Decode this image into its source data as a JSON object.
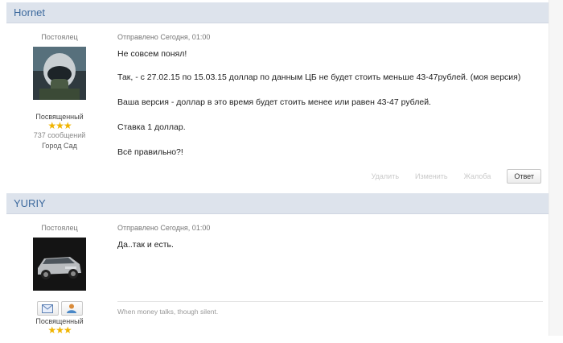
{
  "posts": [
    {
      "author": "Hornet",
      "rank_top": "Постоялец",
      "rank_name": "Посвященный",
      "stars": "★★★",
      "messages_count": "737 сообщений",
      "city": "Город Сад",
      "meta": "Отправлено Сегодня, 01:00",
      "lines": [
        "Не совсем понял!",
        "Так, - с 27.02.15 по 15.03.15 доллар по данным ЦБ не будет стоить меньше 43-47рублей. (моя версия)",
        "Ваша версия - доллар в это время будет стоить менее или равен  43-47 рублей.",
        "Ставка 1 доллар.",
        "Всё правильно?!"
      ],
      "actions": {
        "delete": "Удалить",
        "edit": "Изменить",
        "report": "Жалоба",
        "reply": "Ответ"
      }
    },
    {
      "author": "YURIY",
      "rank_top": "Постоялец",
      "rank_name": "Посвященный",
      "stars": "★★★",
      "meta": "Отправлено Сегодня, 01:00",
      "lines": [
        "Да..так и есть."
      ],
      "signature": "When money talks, though silent."
    }
  ],
  "colors": {
    "header_bg": "#dde3ec",
    "author_link": "#3d6a9e",
    "stars": "#f0b400"
  },
  "icons": [
    "pilot-avatar",
    "suv-avatar",
    "message-icon",
    "user-icon"
  ]
}
